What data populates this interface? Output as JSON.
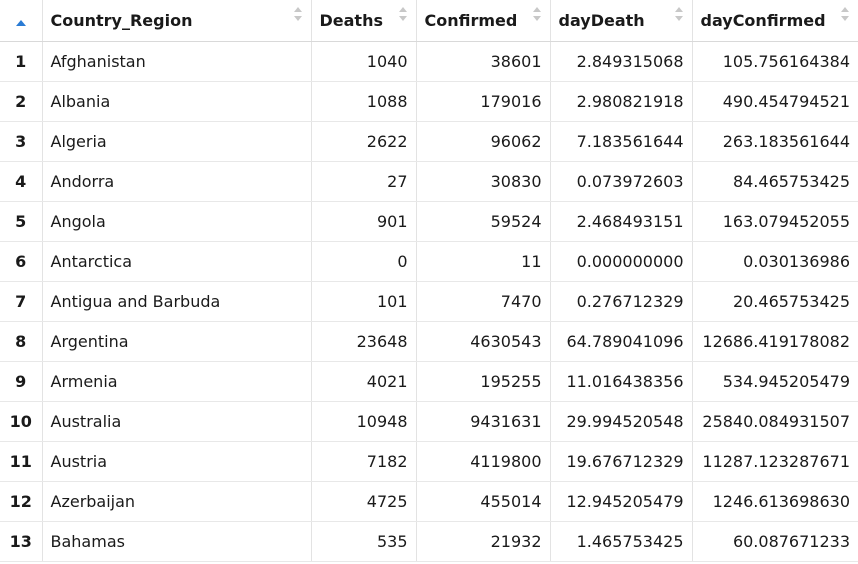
{
  "table": {
    "sort_indicator": "sort-ascending-icon",
    "accent_color": "#2a7bd4",
    "columns": [
      "Country_Region",
      "Deaths",
      "Confirmed",
      "dayDeath",
      "dayConfirmed"
    ],
    "rows": [
      {
        "n": "1",
        "country": "Afghanistan",
        "deaths": "1040",
        "confirmed": "38601",
        "dayDeath": "2.849315068",
        "dayConfirmed": "105.756164384"
      },
      {
        "n": "2",
        "country": "Albania",
        "deaths": "1088",
        "confirmed": "179016",
        "dayDeath": "2.980821918",
        "dayConfirmed": "490.454794521"
      },
      {
        "n": "3",
        "country": "Algeria",
        "deaths": "2622",
        "confirmed": "96062",
        "dayDeath": "7.183561644",
        "dayConfirmed": "263.183561644"
      },
      {
        "n": "4",
        "country": "Andorra",
        "deaths": "27",
        "confirmed": "30830",
        "dayDeath": "0.073972603",
        "dayConfirmed": "84.465753425"
      },
      {
        "n": "5",
        "country": "Angola",
        "deaths": "901",
        "confirmed": "59524",
        "dayDeath": "2.468493151",
        "dayConfirmed": "163.079452055"
      },
      {
        "n": "6",
        "country": "Antarctica",
        "deaths": "0",
        "confirmed": "11",
        "dayDeath": "0.000000000",
        "dayConfirmed": "0.030136986"
      },
      {
        "n": "7",
        "country": "Antigua and Barbuda",
        "deaths": "101",
        "confirmed": "7470",
        "dayDeath": "0.276712329",
        "dayConfirmed": "20.465753425"
      },
      {
        "n": "8",
        "country": "Argentina",
        "deaths": "23648",
        "confirmed": "4630543",
        "dayDeath": "64.789041096",
        "dayConfirmed": "12686.419178082"
      },
      {
        "n": "9",
        "country": "Armenia",
        "deaths": "4021",
        "confirmed": "195255",
        "dayDeath": "11.016438356",
        "dayConfirmed": "534.945205479"
      },
      {
        "n": "10",
        "country": "Australia",
        "deaths": "10948",
        "confirmed": "9431631",
        "dayDeath": "29.994520548",
        "dayConfirmed": "25840.084931507"
      },
      {
        "n": "11",
        "country": "Austria",
        "deaths": "7182",
        "confirmed": "4119800",
        "dayDeath": "19.676712329",
        "dayConfirmed": "11287.123287671"
      },
      {
        "n": "12",
        "country": "Azerbaijan",
        "deaths": "4725",
        "confirmed": "455014",
        "dayDeath": "12.945205479",
        "dayConfirmed": "1246.613698630"
      },
      {
        "n": "13",
        "country": "Bahamas",
        "deaths": "535",
        "confirmed": "21932",
        "dayDeath": "1.465753425",
        "dayConfirmed": "60.087671233"
      }
    ]
  }
}
